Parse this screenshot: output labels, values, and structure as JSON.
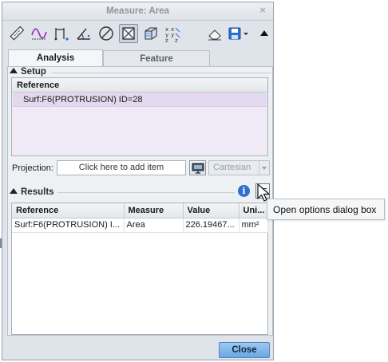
{
  "dialog": {
    "title": "Measure: Area",
    "close_glyph": "×"
  },
  "toolbar": {
    "icons": [
      "ruler-icon",
      "curve-length-icon",
      "distance-icon",
      "angle-icon",
      "diameter-icon",
      "area-icon",
      "volume-icon",
      "transform-icon",
      "eraser-icon",
      "save-icon",
      "collapse-icon"
    ]
  },
  "tabs": [
    {
      "label": "Analysis",
      "active": true
    },
    {
      "label": "Feature",
      "active": false
    }
  ],
  "setup": {
    "heading": "Setup",
    "reference_header": "Reference",
    "reference_item": "Surf:F6(PROTRUSION) ID=28"
  },
  "projection": {
    "label": "Projection:",
    "placeholder": "Click here to add item",
    "coordinate_system": "Cartesian"
  },
  "results": {
    "heading": "Results",
    "info_glyph": "i",
    "columns": [
      "Reference",
      "Measure",
      "Value",
      "Uni..."
    ],
    "rows": [
      {
        "reference": "Surf:F6(PROTRUSION) I...",
        "measure": "Area",
        "value": "226.19467...",
        "unit": "mm²"
      }
    ]
  },
  "tooltip": {
    "text": "Open options dialog box"
  },
  "footer": {
    "close_label": "Close"
  },
  "colors": {
    "selection": "#e3d8ee",
    "primary_button": "#6ba7e0",
    "info": "#2f6fd0"
  }
}
